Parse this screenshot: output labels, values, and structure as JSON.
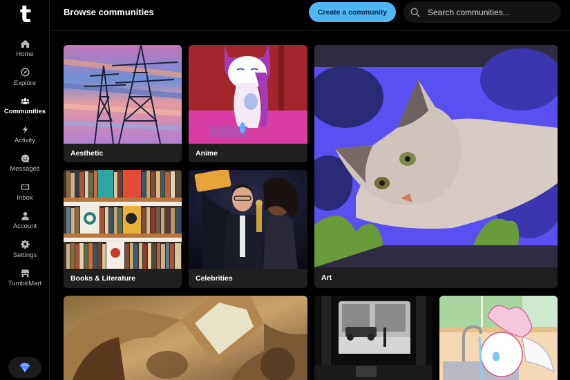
{
  "app": {
    "logo_letter": "t"
  },
  "sidebar": {
    "items": [
      {
        "label": "Home",
        "icon": "home-icon",
        "active": false
      },
      {
        "label": "Explore",
        "icon": "compass-icon",
        "active": false
      },
      {
        "label": "Communities",
        "icon": "people-icon",
        "active": true
      },
      {
        "label": "Activity",
        "icon": "lightning-icon",
        "active": false
      },
      {
        "label": "Messages",
        "icon": "smiley-chat-icon",
        "active": false
      },
      {
        "label": "Inbox",
        "icon": "envelope-icon",
        "active": false
      },
      {
        "label": "Account",
        "icon": "person-icon",
        "active": false
      },
      {
        "label": "Settings",
        "icon": "gear-icon",
        "active": false
      },
      {
        "label": "TumblrMart",
        "icon": "storefront-icon",
        "active": false
      }
    ],
    "premium_icon": "diamond-icon"
  },
  "header": {
    "title": "Browse communities",
    "create_button": "Create a community",
    "search_placeholder": "Search communities..."
  },
  "colors": {
    "accent": "#4fb5f5",
    "background": "#000000",
    "card_caption_bg": "#1f1f1f",
    "premium_diamond": "#4a7dff"
  },
  "communities": [
    {
      "name": "Aesthetic",
      "image": "pastel sky with power transmission towers"
    },
    {
      "name": "Anime",
      "image": "white cat in pink hood holding a jar"
    },
    {
      "name": "Art",
      "image": "illustrated cat among purple anemone flowers"
    },
    {
      "name": "Books & Literature",
      "image": "bookshelves with colorful book spines"
    },
    {
      "name": "Celebrities",
      "image": "celebrities taking a selfie with a trophy"
    },
    {
      "name": "",
      "image": "ornate painted baroque ceiling"
    },
    {
      "name": "",
      "image": "black and white silent film in theater"
    },
    {
      "name": "",
      "image": "pastel cartoon creature at a sink"
    }
  ]
}
